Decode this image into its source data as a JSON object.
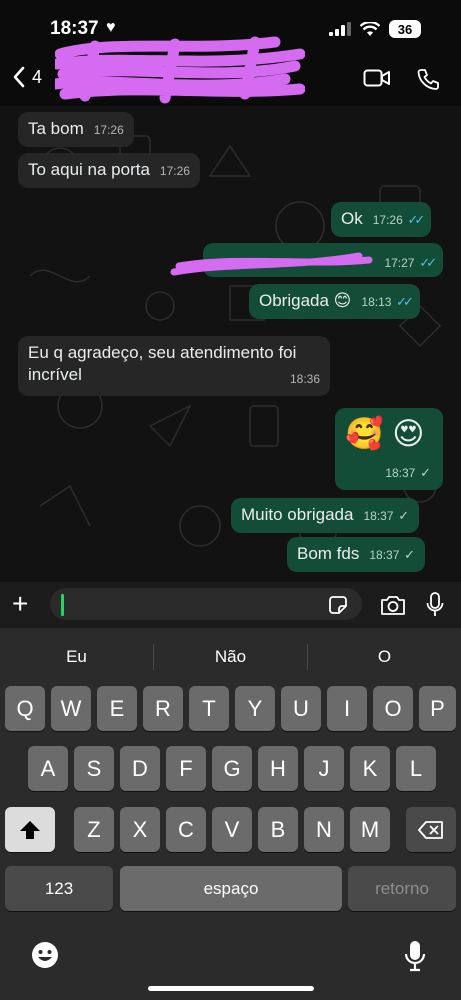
{
  "status": {
    "time": "18:37",
    "battery": "36"
  },
  "header": {
    "back_count": "4"
  },
  "messages": [
    {
      "dir": "in",
      "text": "Ta bom",
      "time": "17:26"
    },
    {
      "dir": "in",
      "text": "To aqui na porta",
      "time": "17:26"
    },
    {
      "dir": "out",
      "text": "Ok",
      "time": "17:26",
      "status": "read"
    },
    {
      "dir": "out",
      "text": "",
      "time": "17:27",
      "status": "read"
    },
    {
      "dir": "out",
      "text": "Obrigada 😊",
      "time": "18:13",
      "status": "read"
    },
    {
      "dir": "in",
      "text": "Eu q agradeço, seu atendimento foi incrível",
      "time": "18:36"
    },
    {
      "dir": "out",
      "text": "🥰 😍",
      "time": "18:37",
      "status": "sent"
    },
    {
      "dir": "out",
      "text": "Muito obrigada",
      "time": "18:37",
      "status": "sent"
    },
    {
      "dir": "out",
      "text": "Bom fds",
      "time": "18:37",
      "status": "sent"
    }
  ],
  "composer": {
    "value": ""
  },
  "keyboard": {
    "suggestions": [
      "Eu",
      "Não",
      "O"
    ],
    "row1": [
      "Q",
      "W",
      "E",
      "R",
      "T",
      "Y",
      "U",
      "I",
      "O",
      "P"
    ],
    "row2": [
      "A",
      "S",
      "D",
      "F",
      "G",
      "H",
      "J",
      "K",
      "L"
    ],
    "row3": [
      "Z",
      "X",
      "C",
      "V",
      "B",
      "N",
      "M"
    ],
    "numbers_key": "123",
    "space_key": "espaço",
    "return_key": "retorno"
  },
  "colors": {
    "outgoing": "#134d37",
    "incoming": "#262626",
    "read_tick": "#53bdeb",
    "accent": "#25d366",
    "redaction": "#d46bf0"
  }
}
